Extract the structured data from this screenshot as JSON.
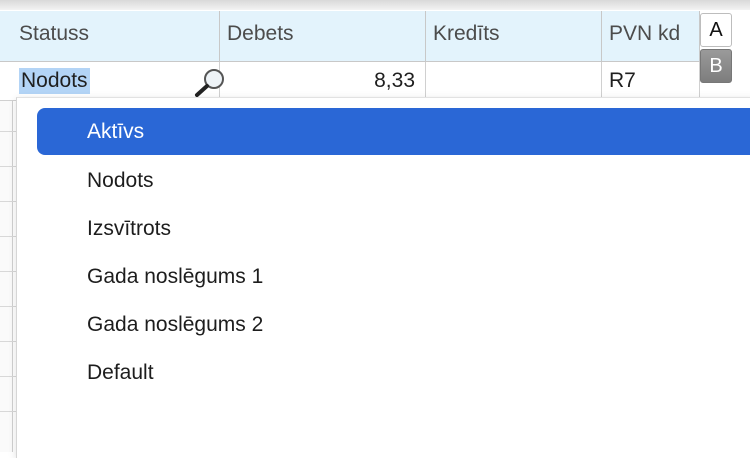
{
  "table": {
    "columns": [
      "Statuss",
      "Debets",
      "Kredīts",
      "PVN kd"
    ],
    "row": {
      "status": "Nodots",
      "debit": "8,33",
      "credit": "",
      "vat_code": "R7"
    }
  },
  "side_tabs": [
    "A",
    "B"
  ],
  "dropdown": {
    "options": [
      "Aktīvs",
      "Nodots",
      "Izsvītrots",
      "Gada noslēgums 1",
      "Gada noslēgums 2",
      "Default"
    ],
    "highlighted": "Aktīvs"
  },
  "colors": {
    "header_bg": "#e3f3fc",
    "selection_bg": "#2a67d6",
    "text_selection": "#b3d4f6"
  },
  "icons": {
    "lookup": "magnifier-icon"
  }
}
